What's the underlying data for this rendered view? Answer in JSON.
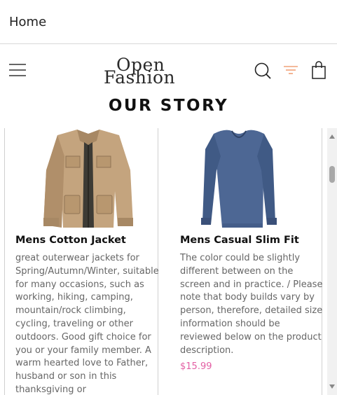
{
  "topbar": {
    "home_label": "Home"
  },
  "header": {
    "logo_line1": "Open",
    "logo_line2": "Fashion",
    "icons": [
      "menu-icon",
      "search-icon",
      "filter-icon",
      "bag-icon"
    ],
    "filter_color": "#f0a278"
  },
  "page": {
    "title": "OUR STORY"
  },
  "products": [
    {
      "name": "Mens Cotton Jacket",
      "description": "great outerwear jackets for Spring/Autumn/Winter, suitable for many occasions, such as working, hiking, camping, mountain/rock climbing, cycling, traveling or other outdoors. Good gift choice for you or your family member. A warm hearted love to Father, husband or son in this thanksgiving or",
      "image": "jacket-image"
    },
    {
      "name": "Mens Casual Slim Fit",
      "description": "The color could be slightly different between on the screen and in practice. / Please note that body builds vary by person, therefore, detailed size information should be reviewed below on the product description.",
      "price": "$15.99",
      "image": "shirt-image"
    }
  ],
  "colors": {
    "price": "#e35fa4",
    "divider": "#d0d0d0"
  }
}
